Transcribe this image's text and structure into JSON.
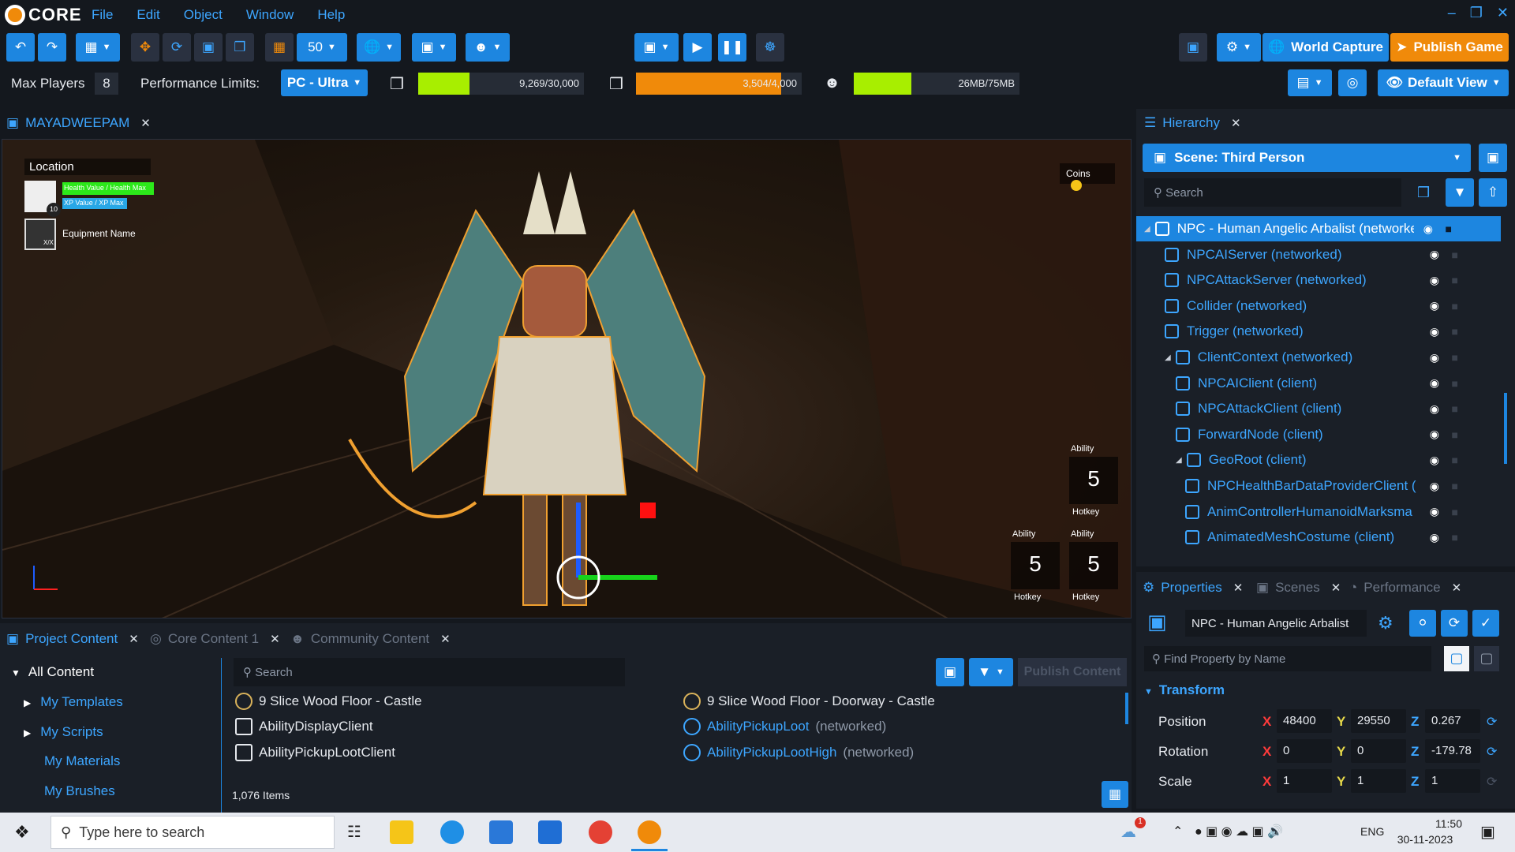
{
  "app": {
    "logo": "CORE",
    "menu": [
      "File",
      "Edit",
      "Object",
      "Window",
      "Help"
    ]
  },
  "toolbar": {
    "snap_value": "50",
    "world_capture": "World Capture",
    "publish_game": "Publish Game",
    "default_view": "Default View"
  },
  "perf": {
    "max_players_label": "Max Players",
    "max_players_value": "8",
    "limits_label": "Performance Limits:",
    "limits_value": "PC - Ultra",
    "meters": [
      {
        "text": "9,269/30,000",
        "fraction": 0.309,
        "color": "#a8ee00"
      },
      {
        "text": "3,504/4,000",
        "fraction": 0.876,
        "color": "#f08a0a"
      },
      {
        "text": "26MB/75MB",
        "fraction": 0.347,
        "color": "#a8ee00"
      }
    ]
  },
  "viewport": {
    "tab": "MAYADWEEPAM",
    "hud": {
      "location": "Location",
      "health": "Health Value / Health Max",
      "xp": "XP Value / XP Max",
      "level": "10",
      "equipment": "Equipment Name",
      "equip_count": "X/X",
      "coins": "Coins",
      "ability": "Ability",
      "hotkey": "Hotkey",
      "ability_count": "5"
    }
  },
  "hierarchy": {
    "tab": "Hierarchy",
    "scene": "Scene: Third Person",
    "search_placeholder": "Search",
    "rows": [
      {
        "label": "NPC - Human Angelic Arbalist (networked)",
        "indent": 0,
        "selected": true
      },
      {
        "label": "NPCAIServer (networked)",
        "indent": 1
      },
      {
        "label": "NPCAttackServer (networked)",
        "indent": 1
      },
      {
        "label": "Collider (networked)",
        "indent": 1
      },
      {
        "label": "Trigger (networked)",
        "indent": 1
      },
      {
        "label": "ClientContext (networked)",
        "indent": 1
      },
      {
        "label": "NPCAIClient (client)",
        "indent": 2
      },
      {
        "label": "NPCAttackClient (client)",
        "indent": 2
      },
      {
        "label": "ForwardNode (client)",
        "indent": 2
      },
      {
        "label": "GeoRoot (client)",
        "indent": 2
      },
      {
        "label": "NPCHealthBarDataProviderClient (",
        "indent": 3
      },
      {
        "label": "AnimControllerHumanoidMarksma",
        "indent": 3
      },
      {
        "label": "AnimatedMeshCostume (client)",
        "indent": 3
      }
    ]
  },
  "properties": {
    "tabs": [
      "Properties",
      "Scenes",
      "Performance"
    ],
    "object_name": "NPC - Human Angelic Arbalist",
    "find_placeholder": "Find Property by Name",
    "section": "Transform",
    "position": {
      "label": "Position",
      "x": "48400",
      "y": "29550",
      "z": "0.267"
    },
    "rotation": {
      "label": "Rotation",
      "x": "0",
      "y": "0",
      "z": "-179.78"
    },
    "scale": {
      "label": "Scale",
      "x": "1",
      "y": "1",
      "z": "1"
    }
  },
  "content": {
    "tabs": [
      "Project Content",
      "Core Content 1",
      "Community Content"
    ],
    "tree": [
      "All Content",
      "My Templates",
      "My Scripts",
      "My Materials",
      "My Brushes"
    ],
    "search_placeholder": "Search",
    "publish_content": "Publish Content",
    "items_left": [
      {
        "name": "9 Slice Wood Floor - Castle",
        "tag": ""
      },
      {
        "name": "AbilityDisplayClient",
        "tag": ""
      },
      {
        "name": "AbilityPickupLootClient",
        "tag": ""
      }
    ],
    "items_right": [
      {
        "name": "9 Slice Wood Floor - Doorway - Castle",
        "tag": ""
      },
      {
        "name": "AbilityPickupLoot",
        "tag": "(networked)"
      },
      {
        "name": "AbilityPickupLootHigh",
        "tag": "(networked)"
      }
    ],
    "count": "1,076 Items"
  },
  "taskbar": {
    "search_placeholder": "Type here to search",
    "lang": "ENG",
    "time": "11:50",
    "date": "30-11-2023",
    "notif_count": "1"
  }
}
